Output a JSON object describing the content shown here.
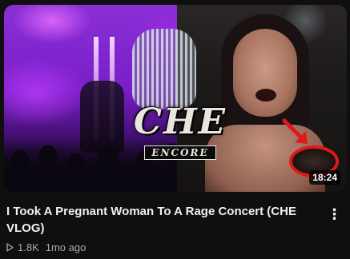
{
  "video": {
    "title": "I Took A Pregnant Woman To A Rage Concert (CHE VLOG)",
    "duration": "18:24",
    "views": "1.8K",
    "age": "1mo ago",
    "thumbnail_logo": {
      "main": "CHE",
      "sub": "ENCORE"
    }
  },
  "icons": {
    "views": "play-outline-icon",
    "menu": "more-vertical-icon"
  },
  "menu_glyph": "⋮",
  "colors": {
    "background": "#0f0f0f",
    "title": "#f1f1f1",
    "meta": "#aaaaaa",
    "annotation": "#e01818"
  }
}
